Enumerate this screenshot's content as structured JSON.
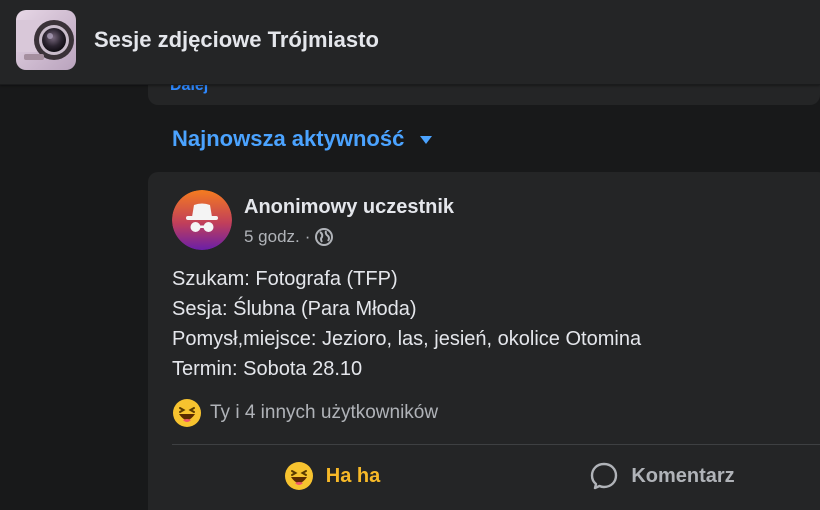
{
  "header": {
    "group_name": "Sesje zdjęciowe Trójmiasto",
    "thumb_icon": "camera-lens-photo"
  },
  "prev_card": {
    "partial_link": "Dalej"
  },
  "activity": {
    "label": "Najnowsza aktywność",
    "caret_icon": "caret-down-icon"
  },
  "post": {
    "author": "Anonimowy uczestnik",
    "avatar_icon": "incognito-icon",
    "time": "5 godz.",
    "separator": "·",
    "audience_icon": "globe-icon",
    "lines": [
      "Szukam: Fotografa (TFP)",
      "Sesja: Ślubna (Para Młoda)",
      "Pomysł,miejsce: Jezioro, las, jesień, okolice Otomina",
      "Termin: Sobota 28.10"
    ],
    "reactions": {
      "emoji_icon": "haha-emoji-icon",
      "summary": "Ty i 4 innych użytkowników"
    },
    "actions": {
      "haha_label": "Ha ha",
      "comment_label": "Komentarz"
    }
  },
  "colors": {
    "background": "#18191a",
    "card": "#242526",
    "link_blue": "#4ba3ff",
    "haha_yellow": "#f7b928",
    "secondary_text": "#b0b3b8"
  }
}
